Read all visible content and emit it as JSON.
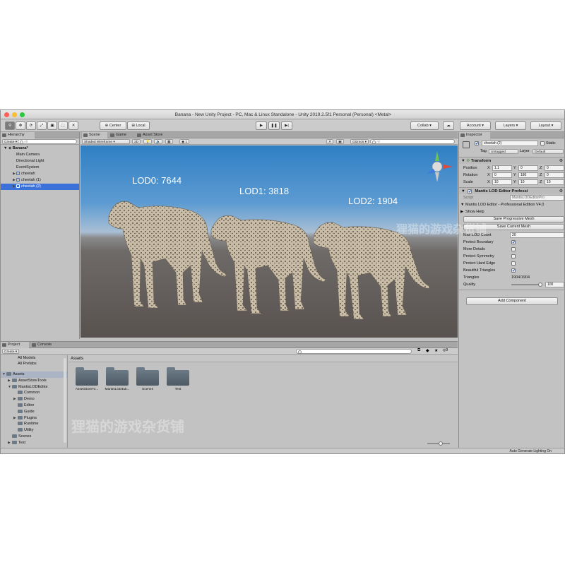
{
  "window": {
    "title": "Banana - New Unity Project - PC, Mac & Linux Standalone - Unity 2019.2.5f1 Personal (Personal) <Metal>"
  },
  "toolbar": {
    "center_label": "Center",
    "local_label": "Local",
    "collab_label": "Collab ▾",
    "account_label": "Account ▾",
    "layers_label": "Layers ▾",
    "layout_label": "Layout ▾"
  },
  "hierarchy": {
    "tab": "Hierarchy",
    "create_label": "Create ▾",
    "search_placeholder": "All",
    "scene_name": "Banana*",
    "items": [
      {
        "label": "Main Camera"
      },
      {
        "label": "Directional Light"
      },
      {
        "label": "EventSystem"
      },
      {
        "label": "cheetah"
      },
      {
        "label": "cheetah (1)"
      },
      {
        "label": "cheetah (2)"
      }
    ]
  },
  "scene": {
    "tabs": [
      "Scene",
      "Game",
      "Asset Store"
    ],
    "shading_mode": "Shaded Wireframe",
    "mode_2d": "2D",
    "layer_count": "1",
    "gizmos_label": "Gizmos ▾",
    "search_placeholder": "All",
    "lod_labels": [
      "LOD0: 7644",
      "LOD1: 3818",
      "LOD2: 1904"
    ]
  },
  "inspector": {
    "tab": "Inspector",
    "object_name": "cheetah (2)",
    "static_label": "Static",
    "tag_label": "Tag",
    "tag_value": "Untagged",
    "layer_label": "Layer",
    "layer_value": "Default",
    "transform_title": "Transform",
    "position_label": "Position",
    "rotation_label": "Rotation",
    "scale_label": "Scale",
    "position": {
      "x": "1.1",
      "y": "0",
      "z": "0"
    },
    "rotation": {
      "x": "0",
      "y": "180",
      "z": "0"
    },
    "scale": {
      "x": "10",
      "y": "10",
      "z": "10"
    },
    "component_title": "Mantis LOD Editor Professi",
    "script_label": "Script",
    "script_value": "MantisLODEditorPro",
    "edition_text": "Mantis LOD Editor - Professional Edition V4.0",
    "show_help": "Show Help",
    "save_progressive_label": "Save Progressive Mesh",
    "save_current_label": "Save Current Mesh",
    "max_lod_label": "Max LOD Count",
    "max_lod_value": "20",
    "protect_boundary": "Protect Boundary",
    "more_details": "More Details",
    "protect_symmetry": "Protect Symmetry",
    "protect_hard_edge": "Protect Hard Edge",
    "beautiful_triangles": "Beautiful Triangles",
    "triangles_label": "Triangles",
    "triangles_value": "1904/1904",
    "quality_label": "Quality",
    "quality_value": "100",
    "add_component_label": "Add Component"
  },
  "project": {
    "tabs": [
      "Project",
      "Console"
    ],
    "create_label": "Create ▾",
    "favorites": [
      "All Models",
      "All Prefabs"
    ],
    "tree": [
      {
        "label": "Assets",
        "depth": 0
      },
      {
        "label": "AssetStoreTools",
        "depth": 1
      },
      {
        "label": "MantisLODEditor",
        "depth": 1
      },
      {
        "label": "Common",
        "depth": 2
      },
      {
        "label": "Demo",
        "depth": 2
      },
      {
        "label": "Editor",
        "depth": 2
      },
      {
        "label": "Guide",
        "depth": 2
      },
      {
        "label": "Plugins",
        "depth": 2
      },
      {
        "label": "Runtime",
        "depth": 2
      },
      {
        "label": "Utility",
        "depth": 2
      },
      {
        "label": "Scenes",
        "depth": 1
      },
      {
        "label": "Test",
        "depth": 1
      }
    ],
    "breadcrumb": "Assets",
    "folders": [
      "AssetStoreTo...",
      "MantisLODEdi...",
      "Scenes",
      "Test"
    ],
    "hidden_count": "9"
  },
  "status": {
    "right_text": "Auto Generate Lighting On"
  },
  "watermark": "狸猫的游戏杂货铺"
}
